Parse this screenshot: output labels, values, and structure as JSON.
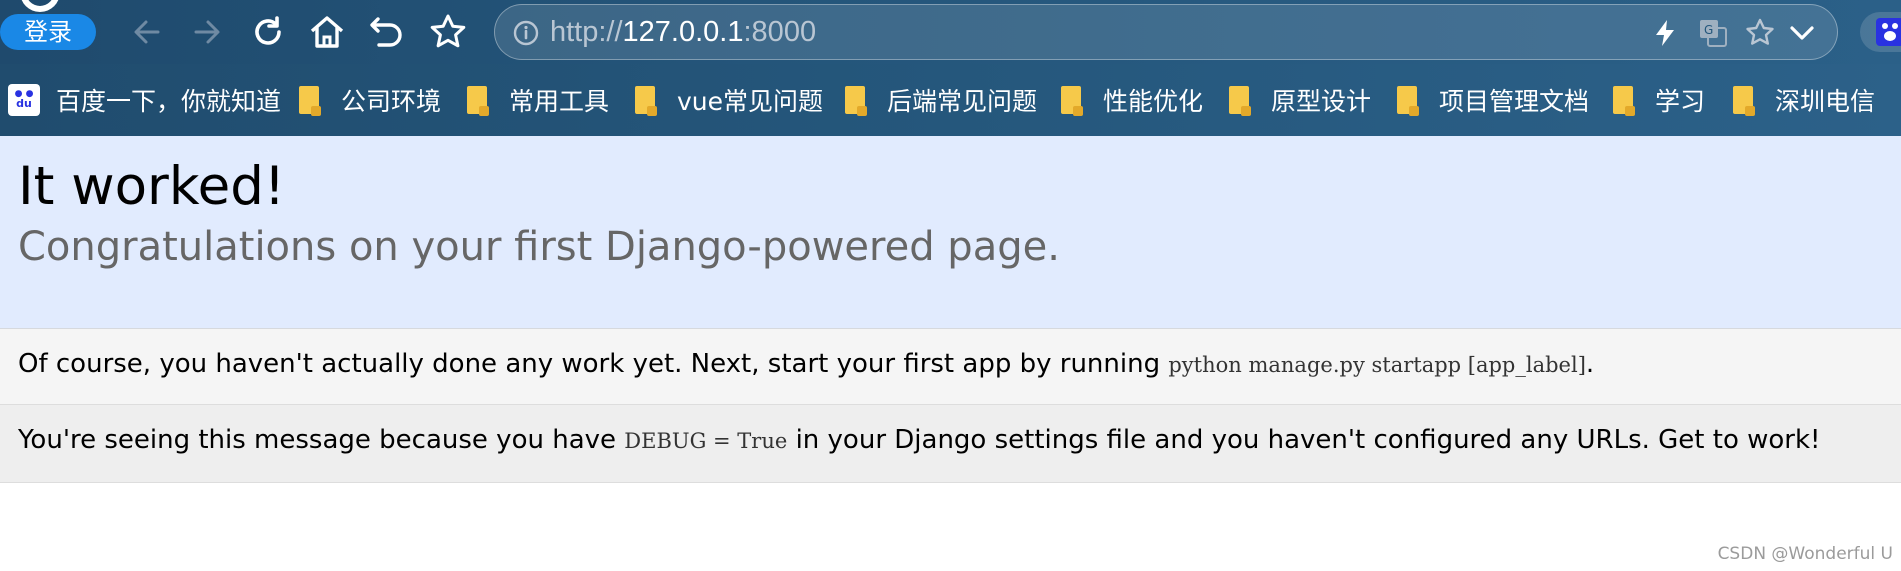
{
  "browser": {
    "login_label": "登录",
    "url_scheme": "http://",
    "url_host": "127.0.0.1",
    "url_port": ":8000"
  },
  "bookmarks": [
    {
      "label": "百度一下，你就知道",
      "icon": "baidu-icon"
    },
    {
      "label": "公司环境",
      "icon": "folder-icon"
    },
    {
      "label": "常用工具",
      "icon": "folder-icon"
    },
    {
      "label": "vue常见问题",
      "icon": "folder-icon"
    },
    {
      "label": "后端常见问题",
      "icon": "folder-icon"
    },
    {
      "label": "性能优化",
      "icon": "folder-icon"
    },
    {
      "label": "原型设计",
      "icon": "folder-icon"
    },
    {
      "label": "项目管理文档",
      "icon": "folder-icon"
    },
    {
      "label": "学习",
      "icon": "folder-icon"
    },
    {
      "label": "深圳电信",
      "icon": "folder-icon"
    }
  ],
  "page": {
    "title": "It worked!",
    "subtitle": "Congratulations on your first Django-powered page.",
    "instructions_text": "Of course, you haven't actually done any work yet. Next, start your first app by running ",
    "instructions_code": "python manage.py startapp [app_label]",
    "instructions_end": ".",
    "explanation_pre": "You're seeing this message because you have ",
    "explanation_code": "DEBUG = True",
    "explanation_post": " in your Django settings file and you haven't configured any URLs. Get to work!"
  },
  "watermark": "CSDN @Wonderful    U",
  "colors": {
    "toolbar": "#24557a",
    "hero_bg": "#e1ebfe",
    "instructions_bg": "#f5f5f5",
    "explanation_bg": "#eeeeee",
    "folder": "#f6c94a",
    "login_btn": "#1a88e6"
  }
}
